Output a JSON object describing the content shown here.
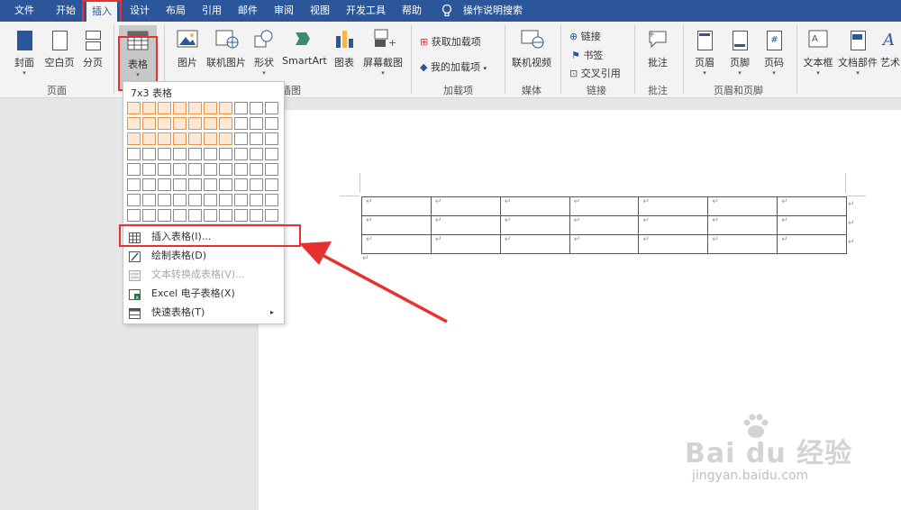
{
  "tabs": [
    "文件",
    "开始",
    "插入",
    "设计",
    "布局",
    "引用",
    "邮件",
    "审阅",
    "视图",
    "开发工具",
    "帮助"
  ],
  "search": {
    "label": "操作说明搜索"
  },
  "ribbon": {
    "pages": {
      "cover": "封面",
      "blank": "空白页",
      "break": "分页",
      "group": "页面"
    },
    "table": {
      "label": "表格"
    },
    "illustrations": {
      "picture": "图片",
      "online_picture": "联机图片",
      "shapes": "形状",
      "smartart": "SmartArt",
      "chart": "图表",
      "screenshot": "屏幕截图",
      "group_partial": "插图"
    },
    "addins": {
      "get": "获取加载项",
      "mine": "我的加载项",
      "group": "加载项"
    },
    "media": {
      "online_video": "联机视频",
      "group": "媒体"
    },
    "links": {
      "link": "链接",
      "bookmark": "书签",
      "crossref": "交叉引用",
      "group": "链接"
    },
    "comments": {
      "comment": "批注",
      "group": "批注"
    },
    "header_footer": {
      "header": "页眉",
      "footer": "页脚",
      "page_number": "页码",
      "group": "页眉和页脚"
    },
    "text": {
      "textbox": "文本框",
      "quickparts": "文档部件",
      "wordart": "艺术"
    }
  },
  "dropdown": {
    "title": "7x3 表格",
    "grid_cols": 10,
    "grid_rows": 8,
    "sel_cols": 7,
    "sel_rows": 3,
    "items": [
      {
        "label": "插入表格(I)...",
        "disabled": false
      },
      {
        "label": "绘制表格(D)",
        "disabled": false
      },
      {
        "label": "文本转换成表格(V)...",
        "disabled": true
      },
      {
        "label": "Excel 电子表格(X)",
        "disabled": false
      },
      {
        "label": "快速表格(T)",
        "disabled": false
      }
    ]
  },
  "doc_table": {
    "cols": 7,
    "rows": 3,
    "mark": "↵"
  },
  "watermark": {
    "logo": "Bai du 经验",
    "url": "jingyan.baidu.com"
  },
  "colors": {
    "accent": "#2b579a",
    "highlight": "#e8302f",
    "grid_select": "#f0913e"
  }
}
